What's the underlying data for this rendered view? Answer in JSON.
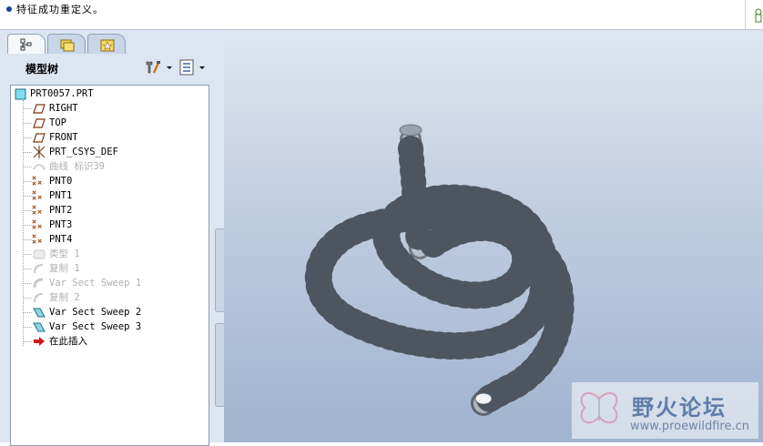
{
  "message_bar": {
    "text": "特征成功重定义。"
  },
  "model_tree": {
    "title": "模型树",
    "items": [
      {
        "label": "PRT0057.PRT",
        "icon": "part-icon",
        "state": "normal"
      },
      {
        "label": "RIGHT",
        "icon": "datum-plane-icon",
        "state": "normal"
      },
      {
        "label": "TOP",
        "icon": "datum-plane-icon",
        "state": "normal"
      },
      {
        "label": "FRONT",
        "icon": "datum-plane-icon",
        "state": "normal"
      },
      {
        "label": "PRT_CSYS_DEF",
        "icon": "csys-icon",
        "state": "normal"
      },
      {
        "label": "曲线 标识39",
        "icon": "curve-icon",
        "state": "suppressed"
      },
      {
        "label": "PNT0",
        "icon": "datum-point-icon",
        "state": "normal"
      },
      {
        "label": "PNT1",
        "icon": "datum-point-icon",
        "state": "normal"
      },
      {
        "label": "PNT2",
        "icon": "datum-point-icon",
        "state": "normal"
      },
      {
        "label": "PNT3",
        "icon": "datum-point-icon",
        "state": "normal"
      },
      {
        "label": "PNT4",
        "icon": "datum-point-icon",
        "state": "normal"
      },
      {
        "label": "类型 1",
        "icon": "feature-icon",
        "state": "suppressed"
      },
      {
        "label": "复制 1",
        "icon": "copy-icon",
        "state": "suppressed"
      },
      {
        "label": "Var Sect Sweep 1",
        "icon": "sweep-icon",
        "state": "suppressed"
      },
      {
        "label": "复制 2",
        "icon": "copy-icon",
        "state": "suppressed"
      },
      {
        "label": "Var Sect Sweep 2",
        "icon": "sweep-icon",
        "state": "normal"
      },
      {
        "label": "Var Sect Sweep 3",
        "icon": "sweep-icon",
        "state": "normal"
      },
      {
        "label": "在此插入",
        "icon": "insert-here-arrow-icon",
        "state": "normal"
      }
    ]
  },
  "watermark": {
    "title": "野火论坛",
    "url": "www.proewildfire.cn"
  },
  "colors": {
    "viewport_top": "#dfe6f0",
    "viewport_bottom": "#9fb3cf",
    "model": "#b9c0c8",
    "insert_arrow": "#d11a1a"
  }
}
